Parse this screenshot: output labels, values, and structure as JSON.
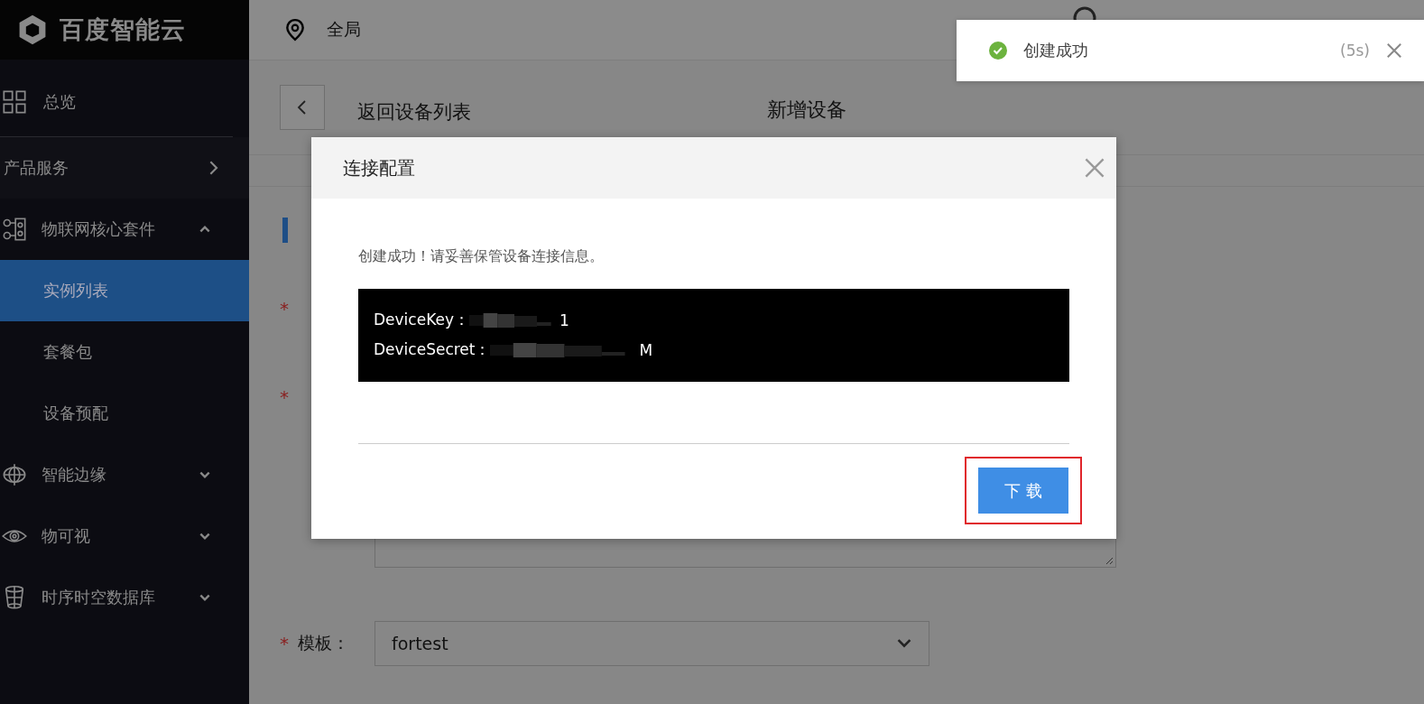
{
  "sidebar": {
    "logo": "百度智能云",
    "items": [
      {
        "kind": "link",
        "label": "总览"
      },
      {
        "kind": "section",
        "label": "产品服务"
      },
      {
        "kind": "group",
        "label": "物联网核心套件",
        "expanded": true,
        "children": [
          {
            "label": "实例列表",
            "selected": true
          },
          {
            "label": "套餐包",
            "selected": false
          },
          {
            "label": "设备预配",
            "selected": false
          }
        ]
      },
      {
        "kind": "group",
        "label": "智能边缘",
        "expanded": false
      },
      {
        "kind": "group",
        "label": "物可视",
        "expanded": false
      },
      {
        "kind": "group",
        "label": "时序时空数据库",
        "expanded": false
      }
    ]
  },
  "header": {
    "region": "全局"
  },
  "page": {
    "back_label": "返回设备列表",
    "title": "新增设备"
  },
  "form": {
    "rows": [
      {
        "kind": "input",
        "mark": "*"
      },
      {
        "kind": "input",
        "mark": "*"
      },
      {
        "kind": "textarea"
      },
      {
        "kind": "select",
        "mark": "*",
        "label": "模板：",
        "value": "fortest"
      }
    ]
  },
  "modal": {
    "title": "连接配置",
    "message": "创建成功！请妥善保管设备连接信息。",
    "credentials": [
      {
        "label": "DeviceKey：",
        "tail": "1"
      },
      {
        "label": "DeviceSecret：",
        "tail": "M"
      }
    ],
    "button": {
      "label": "下 载",
      "highlighted": true
    }
  },
  "toast": {
    "message": "创建成功",
    "countdown": "(5s)"
  }
}
